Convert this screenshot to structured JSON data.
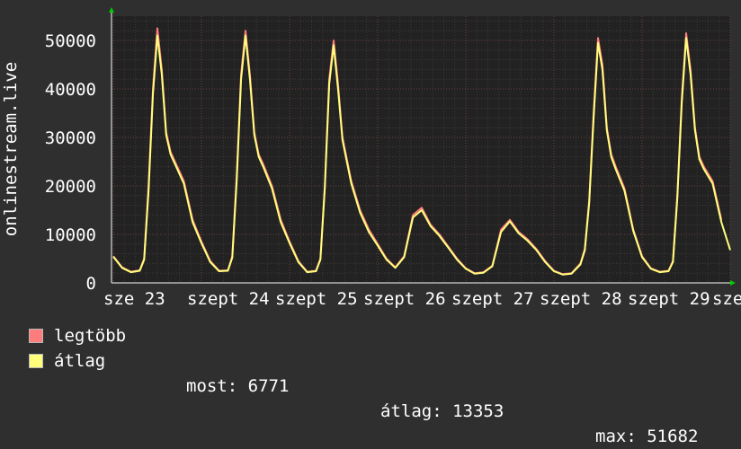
{
  "chart_data": {
    "type": "line",
    "ylabel": "onlinestream.live",
    "y_ticks": [
      "0",
      "10000",
      "20000",
      "30000",
      "40000",
      "50000"
    ],
    "ylim": [
      0,
      55000
    ],
    "x_tick_labels": [
      "sze 23",
      "szept 24",
      "szept 25",
      "szept 26",
      "szept 27",
      "szept 28",
      "szept 29",
      "szept"
    ],
    "x_range_days": [
      0,
      7
    ],
    "grid": true,
    "legend_placement": "bottom-left",
    "series": [
      {
        "name": "legtöbb",
        "color": "#ff7c7c",
        "x": [
          0,
          0.1,
          0.2,
          0.3,
          0.35,
          0.4,
          0.45,
          0.5,
          0.55,
          0.6,
          0.65,
          0.7,
          0.8,
          0.9,
          1.0,
          1.1,
          1.2,
          1.3,
          1.35,
          1.4,
          1.45,
          1.5,
          1.55,
          1.6,
          1.65,
          1.7,
          1.8,
          1.9,
          2.0,
          2.1,
          2.2,
          2.3,
          2.35,
          2.4,
          2.45,
          2.5,
          2.55,
          2.6,
          2.7,
          2.8,
          2.9,
          3.0,
          3.1,
          3.2,
          3.3,
          3.4,
          3.5,
          3.6,
          3.7,
          3.8,
          3.9,
          4.0,
          4.1,
          4.2,
          4.3,
          4.4,
          4.5,
          4.6,
          4.7,
          4.8,
          4.9,
          5.0,
          5.1,
          5.2,
          5.3,
          5.35,
          5.4,
          5.45,
          5.5,
          5.55,
          5.6,
          5.65,
          5.7,
          5.8,
          5.9,
          6.0,
          6.1,
          6.2,
          6.3,
          6.35,
          6.4,
          6.45,
          6.5,
          6.55,
          6.6,
          6.65,
          6.7,
          6.8,
          6.9
        ],
        "y": [
          5500,
          3200,
          2300,
          2600,
          5000,
          20000,
          40000,
          52500,
          44000,
          31000,
          27000,
          25000,
          21000,
          13000,
          8500,
          4500,
          2500,
          2600,
          5500,
          22000,
          43000,
          52000,
          43000,
          31000,
          26500,
          24500,
          20000,
          13000,
          8500,
          4500,
          2300,
          2500,
          5000,
          20000,
          42000,
          50000,
          41000,
          30000,
          21000,
          15000,
          11000,
          8000,
          5000,
          3200,
          5500,
          14000,
          15500,
          12000,
          10000,
          7500,
          5000,
          3000,
          2000,
          2200,
          3500,
          11000,
          13000,
          10500,
          9000,
          7000,
          4500,
          2500,
          1800,
          2000,
          4000,
          7000,
          17000,
          35000,
          50500,
          45000,
          32000,
          26500,
          24000,
          19500,
          11000,
          5500,
          3000,
          2300,
          2500,
          4500,
          18000,
          38000,
          51500,
          44000,
          32000,
          26000,
          24000,
          21000,
          13000
        ],
        "values_note": ""
      },
      {
        "name": "átlag",
        "color": "#ffff7c",
        "x": [
          0,
          0.1,
          0.2,
          0.3,
          0.35,
          0.4,
          0.45,
          0.5,
          0.55,
          0.6,
          0.65,
          0.7,
          0.8,
          0.9,
          1.0,
          1.1,
          1.2,
          1.3,
          1.35,
          1.4,
          1.45,
          1.5,
          1.55,
          1.6,
          1.65,
          1.7,
          1.8,
          1.9,
          2.0,
          2.1,
          2.2,
          2.3,
          2.35,
          2.4,
          2.45,
          2.5,
          2.55,
          2.6,
          2.7,
          2.8,
          2.9,
          3.0,
          3.1,
          3.2,
          3.3,
          3.4,
          3.5,
          3.6,
          3.7,
          3.8,
          3.9,
          4.0,
          4.1,
          4.2,
          4.3,
          4.4,
          4.5,
          4.6,
          4.7,
          4.8,
          4.9,
          5.0,
          5.1,
          5.2,
          5.3,
          5.35,
          5.4,
          5.45,
          5.5,
          5.55,
          5.6,
          5.65,
          5.7,
          5.8,
          5.9,
          6.0,
          6.1,
          6.2,
          6.3,
          6.35,
          6.4,
          6.45,
          6.5,
          6.55,
          6.6,
          6.65,
          6.7,
          6.8,
          6.9,
          7.0
        ],
        "y": [
          5400,
          3100,
          2200,
          2500,
          4800,
          19000,
          39000,
          51000,
          43000,
          30500,
          26500,
          24500,
          20500,
          12500,
          8200,
          4300,
          2400,
          2500,
          5200,
          21000,
          42000,
          51000,
          42000,
          30500,
          26000,
          24000,
          19500,
          12500,
          8200,
          4300,
          2200,
          2400,
          4800,
          19500,
          41000,
          49000,
          40000,
          29500,
          20500,
          14500,
          10500,
          7700,
          4800,
          3100,
          5300,
          13500,
          15000,
          11700,
          9700,
          7300,
          4800,
          2900,
          1900,
          2100,
          3400,
          10500,
          12700,
          10200,
          8700,
          6800,
          4300,
          2400,
          1700,
          1900,
          3800,
          6700,
          16500,
          34000,
          49500,
          44000,
          31500,
          26000,
          23500,
          19000,
          10700,
          5300,
          2900,
          2200,
          2400,
          4300,
          17500,
          37000,
          50500,
          43000,
          31500,
          25500,
          23500,
          20500,
          12500,
          6771
        ]
      }
    ],
    "stats": {
      "most_label": "most:",
      "most_value": "6771",
      "atlag_label": "átlag:",
      "atlag_value": "13353",
      "max_label": "max:",
      "max_value": "51682"
    }
  }
}
